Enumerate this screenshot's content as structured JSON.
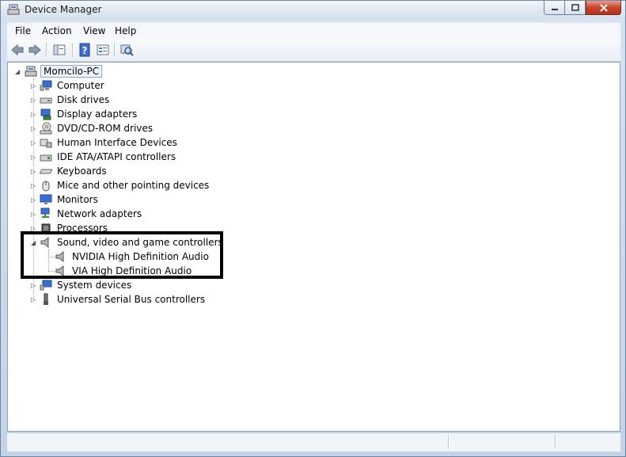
{
  "window": {
    "title": "Device Manager"
  },
  "menu": [
    "File",
    "Action",
    "View",
    "Help"
  ],
  "tree": {
    "root": "Momcilo-PC",
    "categories": [
      "Computer",
      "Disk drives",
      "Display adapters",
      "DVD/CD-ROM drives",
      "Human Interface Devices",
      "IDE ATA/ATAPI controllers",
      "Keyboards",
      "Mice and other pointing devices",
      "Monitors",
      "Network adapters",
      "Processors",
      "Sound, video and game controllers",
      "System devices",
      "Universal Serial Bus controllers"
    ],
    "expanded_children": [
      "NVIDIA High Definition Audio",
      "VIA High Definition Audio"
    ]
  },
  "colors": {
    "highlight_border": "#000000",
    "tree_bg": "#ffffff"
  }
}
